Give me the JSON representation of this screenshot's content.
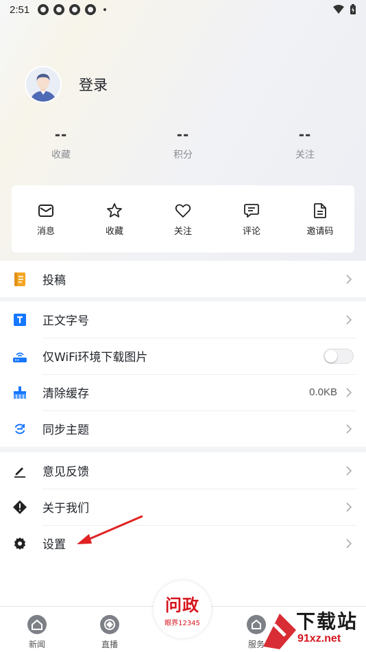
{
  "status_bar": {
    "time": "2:51"
  },
  "profile": {
    "login_label": "登录"
  },
  "stats": [
    {
      "value": "--",
      "label": "收藏"
    },
    {
      "value": "--",
      "label": "积分"
    },
    {
      "value": "--",
      "label": "关注"
    }
  ],
  "quick_actions": [
    {
      "label": "消息",
      "icon": "mail-icon"
    },
    {
      "label": "收藏",
      "icon": "star-icon"
    },
    {
      "label": "关注",
      "icon": "heart-icon"
    },
    {
      "label": "评论",
      "icon": "comment-icon"
    },
    {
      "label": "邀请码",
      "icon": "document-icon"
    }
  ],
  "menu": {
    "group1": [
      {
        "label": "投稿",
        "icon": "submission-icon"
      }
    ],
    "group2": [
      {
        "label": "正文字号",
        "icon": "font-size-icon"
      },
      {
        "label": "仅WiFi环境下载图片",
        "icon": "router-icon",
        "toggle_on": false
      },
      {
        "label": "清除缓存",
        "icon": "brush-icon",
        "value": "0.0KB"
      },
      {
        "label": "同步主题",
        "icon": "sync-icon"
      }
    ],
    "group3": [
      {
        "label": "意见反馈",
        "icon": "pencil-icon"
      },
      {
        "label": "关于我们",
        "icon": "info-diamond-icon"
      },
      {
        "label": "设置",
        "icon": "gear-icon"
      }
    ]
  },
  "tab_bar": {
    "tabs": [
      {
        "label": "新闻",
        "icon": "home-icon"
      },
      {
        "label": "直播",
        "icon": "live-icon"
      },
      {
        "label": "服务",
        "icon": "service-icon"
      }
    ],
    "center": {
      "title": "问政",
      "subtitle": "眼界12345"
    }
  },
  "watermark": {
    "title": "下载站",
    "url": "91xz.net"
  },
  "colors": {
    "accent_orange": "#f5a623",
    "accent_blue": "#1677ff",
    "brand_red": "#d6141c"
  }
}
